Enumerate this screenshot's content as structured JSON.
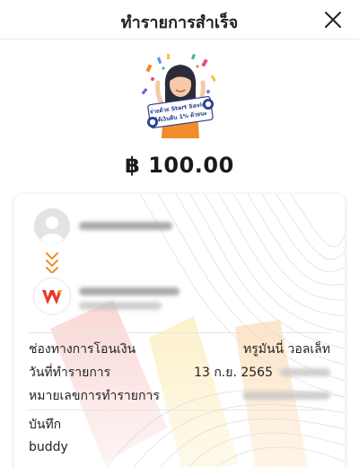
{
  "header": {
    "title": "ทำรายการสำเร็จ",
    "close_icon": "close-icon"
  },
  "illustration": {
    "icon": "celebration-illustration",
    "banner_line1": "จ่ายด้วย Start Saving",
    "banner_line2": "ได้เงินคืน 1% ด้วยนะ"
  },
  "amount": "฿ 100.00",
  "transfer": {
    "sender_avatar_icon": "user-avatar-icon",
    "direction_icon": "chevron-down-double-icon",
    "recipient_logo_icon": "wallet-logo-icon"
  },
  "details": [
    {
      "label": "ช่องทางการโอนเงิน",
      "value": "ทรูมันนี่ วอลเล็ท"
    },
    {
      "label": "วันที่ทำรายการ",
      "value": "13 ก.ย. 2565"
    },
    {
      "label": "หมายเลขการทำรายการ",
      "value": ""
    }
  ],
  "note": {
    "label": "บันทึก",
    "value": "buddy"
  },
  "colors": {
    "accent_orange": "#f28c28",
    "logo_red": "#e8392b",
    "text_dark": "#1f1f1f"
  }
}
